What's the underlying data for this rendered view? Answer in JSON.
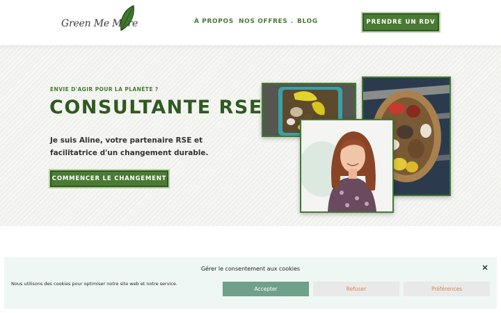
{
  "header": {
    "logo_text": "Green Me More",
    "nav": [
      {
        "label": "À PROPOS"
      },
      {
        "label": "NOS OFFRES",
        "has_dropdown": true
      },
      {
        "label": "BLOG"
      }
    ],
    "cta_label": "PRENDRE UN RDV"
  },
  "hero": {
    "eyebrow": "ENVIE D'AGIR POUR LA PLANÈTE ?",
    "title": "CONSULTANTE RSE",
    "intro": "Je suis Aline, votre partenaire RSE et facilitatrice d'un changement durable.",
    "cta_label": "COMMENCER LE CHANGEMENT"
  },
  "cookie_banner": {
    "title": "Gérer le consentement aux cookies",
    "text": "Nous utilisons des cookies pour optimiser notre site web et notre service.",
    "accept_label": "Accepter",
    "refuse_label": "Refuser",
    "prefs_label": "Préférences"
  },
  "colors": {
    "brand_green": "#4a7a34",
    "dark_green": "#2f5a20",
    "accept_bg": "#6fa08a",
    "secondary_text": "#d0864e"
  },
  "icons": {
    "logo_leaf": "leaf-icon",
    "dropdown": "chevron-down-icon",
    "close": "close-icon"
  }
}
